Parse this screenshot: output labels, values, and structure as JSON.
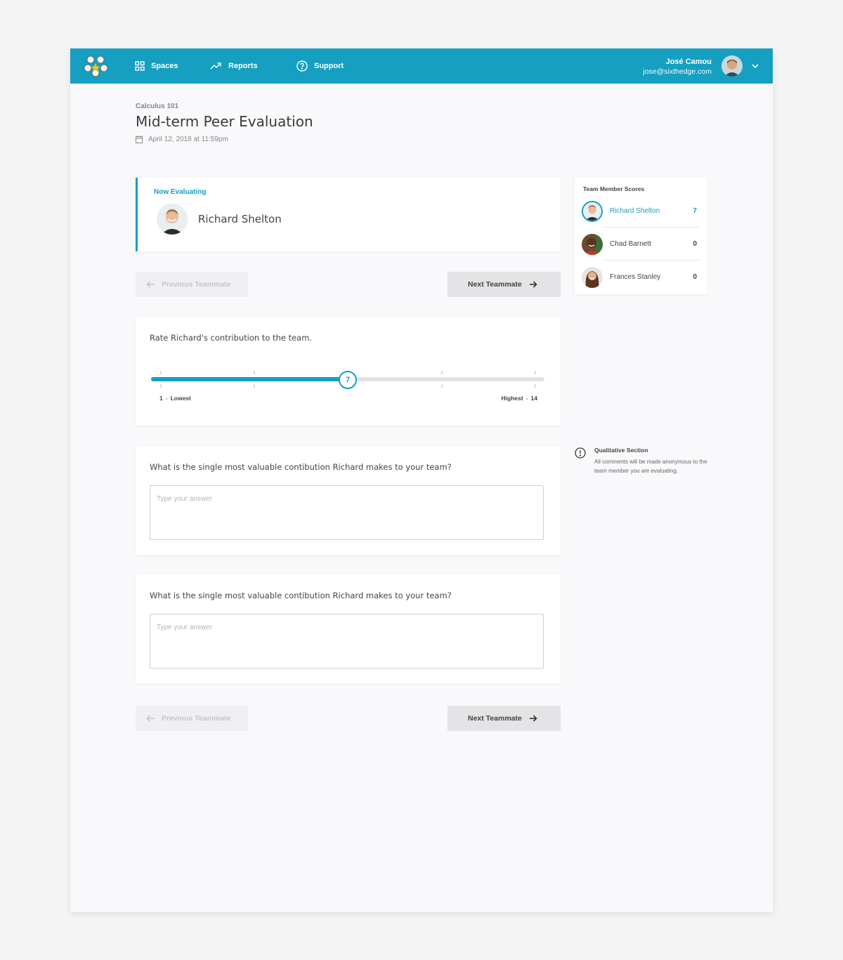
{
  "nav": {
    "items": [
      {
        "label": "Spaces",
        "icon": "grid-icon"
      },
      {
        "label": "Reports",
        "icon": "trend-icon"
      },
      {
        "label": "Support",
        "icon": "help-icon"
      }
    ]
  },
  "user": {
    "name": "José Camou",
    "email": "jose@sixthedge.com"
  },
  "header": {
    "course": "Calculus 101",
    "title": "Mid-term Peer Evaluation",
    "due": "April 12, 2018 at 11:59pm"
  },
  "evaluating": {
    "label": "Now Evaluating",
    "name": "Richard Shelton"
  },
  "buttons": {
    "previous": "Previous Teammate",
    "next": "Next Teammate"
  },
  "rating": {
    "question": "Rate Richard's contribution to the team.",
    "min": 1,
    "max": 14,
    "value": 7,
    "value_label": "7",
    "low_value": "1",
    "low_label": "Lowest",
    "high_label": "Highest",
    "high_value": "14",
    "fill_fraction": 0.5
  },
  "questions": [
    {
      "text": "What is the single most valuable contibution Richard makes to your team?",
      "placeholder": "Type your answer",
      "value": ""
    },
    {
      "text": "What is the single most valuable contibution Richard makes to your team?",
      "placeholder": "Type your answer",
      "value": ""
    }
  ],
  "scores": {
    "title": "Team Member Scores",
    "members": [
      {
        "name": "Richard Shelton",
        "score": "7",
        "active": true
      },
      {
        "name": "Chad Barnett",
        "score": "0",
        "active": false
      },
      {
        "name": "Frances Stanley",
        "score": "0",
        "active": false
      }
    ]
  },
  "qualitative": {
    "title": "Qualitative Section",
    "text": "All comments will be made anonymous to the team member you are evaluating."
  },
  "colors": {
    "accent": "#159fc1",
    "page_bg": "#f9f9fc",
    "outer_bg": "#f4f4f4"
  }
}
